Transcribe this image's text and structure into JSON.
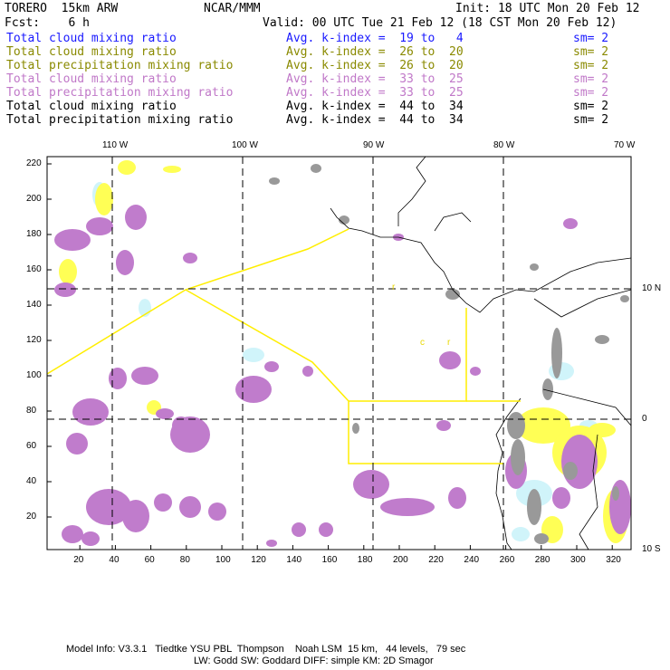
{
  "header": {
    "model": "TORERO  15km ARW",
    "org": "NCAR/MMM",
    "init": "Init: 18 UTC Mon 20 Feb 12",
    "fcst": "Fcst:    6 h",
    "valid": "Valid: 00 UTC Tue 21 Feb 12 (18 CST Mon 20 Feb 12)"
  },
  "legend": [
    {
      "field": "Total cloud mixing ratio",
      "kindex": "Avg. k-index =  19 to   4",
      "sm": "sm= 2",
      "color": "#1a1aff"
    },
    {
      "field": "Total cloud mixing ratio",
      "kindex": "Avg. k-index =  26 to  20",
      "sm": "sm= 2",
      "color": "#8a8a00"
    },
    {
      "field": "Total precipitation mixing ratio",
      "kindex": "Avg. k-index =  26 to  20",
      "sm": "sm= 2",
      "color": "#8a8a00"
    },
    {
      "field": "Total cloud mixing ratio",
      "kindex": "Avg. k-index =  33 to  25",
      "sm": "sm= 2",
      "color": "#c078c8"
    },
    {
      "field": "Total precipitation mixing ratio",
      "kindex": "Avg. k-index =  33 to  25",
      "sm": "sm= 2",
      "color": "#c078c8"
    },
    {
      "field": "Total cloud mixing ratio",
      "kindex": "Avg. k-index =  44 to  34",
      "sm": "sm= 2",
      "color": "#000000"
    },
    {
      "field": "Total precipitation mixing ratio",
      "kindex": "Avg. k-index =  44 to  34",
      "sm": "sm= 2",
      "color": "#000000"
    }
  ],
  "map": {
    "lon_labels": [
      "110 W",
      "100 W",
      "90 W",
      "80 W",
      "70 W"
    ],
    "lat_labels": [
      "10 N",
      "0",
      "10 S"
    ],
    "y_ticks": [
      "220",
      "200",
      "180",
      "160",
      "140",
      "120",
      "100",
      "80",
      "60",
      "40",
      "20"
    ],
    "x_ticks": [
      "20",
      "40",
      "60",
      "80",
      "100",
      "120",
      "140",
      "160",
      "180",
      "200",
      "220",
      "240",
      "260",
      "280",
      "300",
      "320"
    ],
    "region_labels": [
      "r",
      "c",
      "r"
    ],
    "colors": {
      "purple": "#c07ccc",
      "gray": "#999999",
      "yellow": "#ffff55",
      "cyan": "#d0f4fa",
      "boundary": "#ffee00"
    }
  },
  "footer": {
    "line1": "Model Info: V3.3.1   Tiedtke YSU PBL  Thompson    Noah LSM  15 km,   44 levels,   79 sec",
    "line2": "LW: Godd SW: Goddard DIFF: simple KM: 2D Smagor"
  }
}
